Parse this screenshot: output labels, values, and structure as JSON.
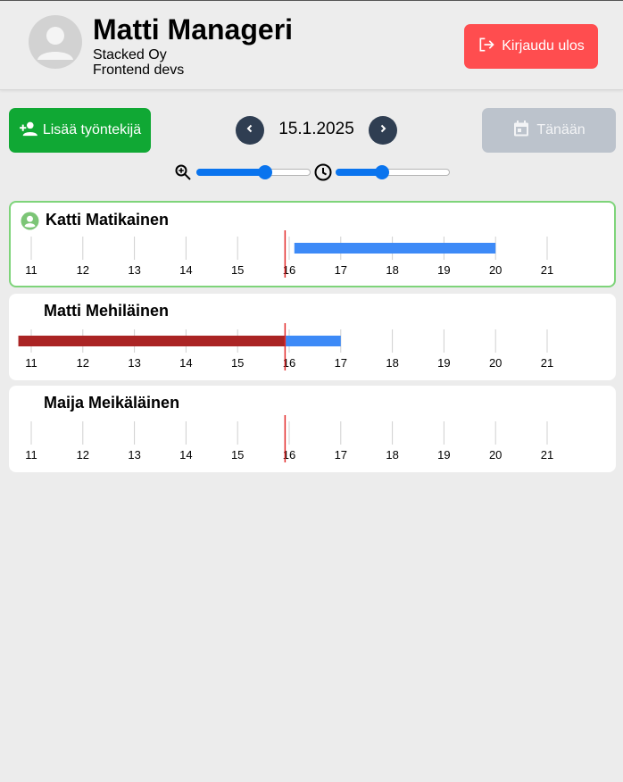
{
  "header": {
    "user_name": "Matti Manageri",
    "company": "Stacked Oy",
    "team": "Frontend devs",
    "logout_label": "Kirjaudu ulos",
    "logout_icon": "logout-icon",
    "avatar_icon": "user-avatar-icon"
  },
  "toolbar": {
    "add_employee_label": "Lisää työntekijä",
    "add_employee_icon": "person-add-icon",
    "date": "15.1.2025",
    "prev_icon": "chevron-left-icon",
    "next_icon": "chevron-right-icon",
    "today_label": "Tänään",
    "today_icon": "calendar-icon",
    "today_disabled": true
  },
  "controls": {
    "zoom_icon": "zoom-in-icon",
    "zoom_level": 0.6,
    "time_icon": "clock-icon",
    "time_position": 0.41
  },
  "timeline": {
    "hours": [
      "11",
      "12",
      "13",
      "14",
      "15",
      "16",
      "17",
      "18",
      "19",
      "20",
      "21"
    ],
    "current_time": 15.92
  },
  "colors": {
    "logout": "#ff4d4f",
    "add_employee": "#10a834",
    "nav_button": "#2f3e52",
    "today_disabled": "#bcc3cc",
    "slider": "#0a74ee",
    "shift_upcoming": "#3d8af7",
    "shift_past": "#aa2424",
    "current_time_line": "#e32a2a",
    "selected_border": "#7ed47a",
    "selected_icon": "#7cc576"
  },
  "employees": [
    {
      "name": "Katti Matikainen",
      "selected": true,
      "shifts": [
        {
          "start": 16.1,
          "end": 20.0,
          "status": "upcoming"
        }
      ]
    },
    {
      "name": "Matti Mehiläinen",
      "selected": false,
      "shifts": [
        {
          "start": 10.75,
          "end": 17.0,
          "status": "in-progress"
        }
      ]
    },
    {
      "name": "Maija Meikäläinen",
      "selected": false,
      "shifts": []
    }
  ]
}
